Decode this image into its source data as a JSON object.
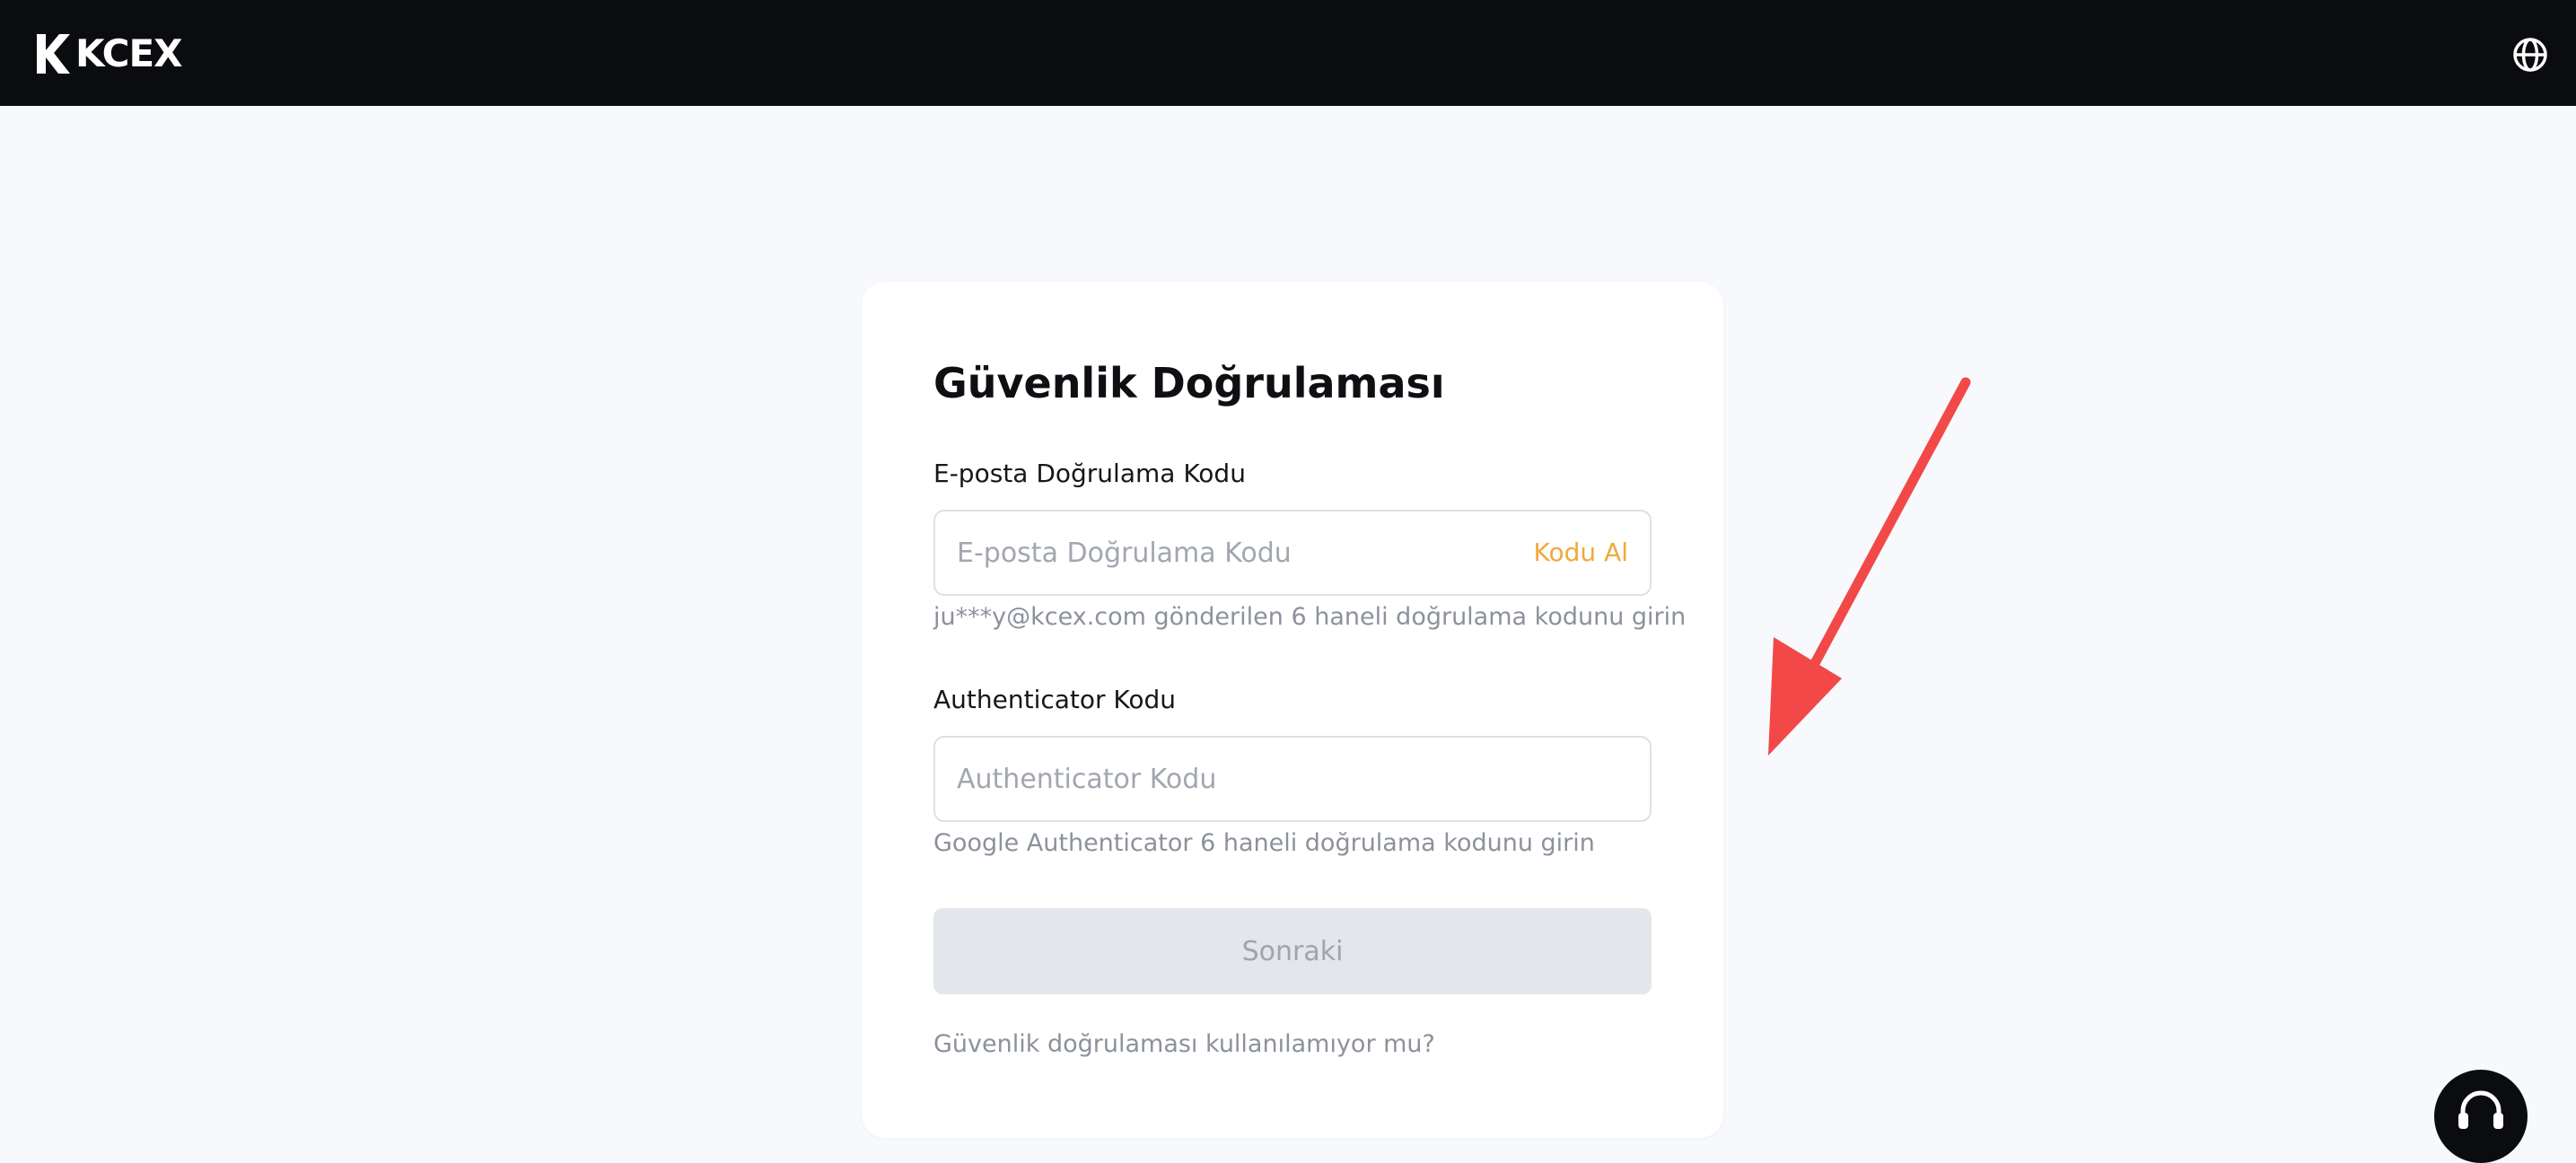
{
  "header": {
    "brand": "KCEX",
    "language_icon": "globe-icon"
  },
  "card": {
    "title": "Güvenlik Doğrulaması",
    "email_code": {
      "label": "E-posta Doğrulama Kodu",
      "placeholder": "E-posta Doğrulama Kodu",
      "value": "",
      "get_code_label": "Kodu Al",
      "hint": "ju***y@kcex.com gönderilen 6 haneli doğrulama kodunu girin"
    },
    "authenticator_code": {
      "label": "Authenticator Kodu",
      "placeholder": "Authenticator Kodu",
      "value": "",
      "hint": "Google Authenticator 6 haneli doğrulama kodunu girin"
    },
    "next_button": "Sonraki",
    "alt_link": "Güvenlik doğrulaması kullanılamıyor mu?"
  },
  "colors": {
    "topbar": "#0b0c0f",
    "page_background": "#f7f9fd",
    "accent": "#f1a93a",
    "disabled_button": "#e3e6ea",
    "annotation_arrow": "#f24848"
  },
  "icons": {
    "support": "headset-icon",
    "annotation": "arrow-icon"
  }
}
